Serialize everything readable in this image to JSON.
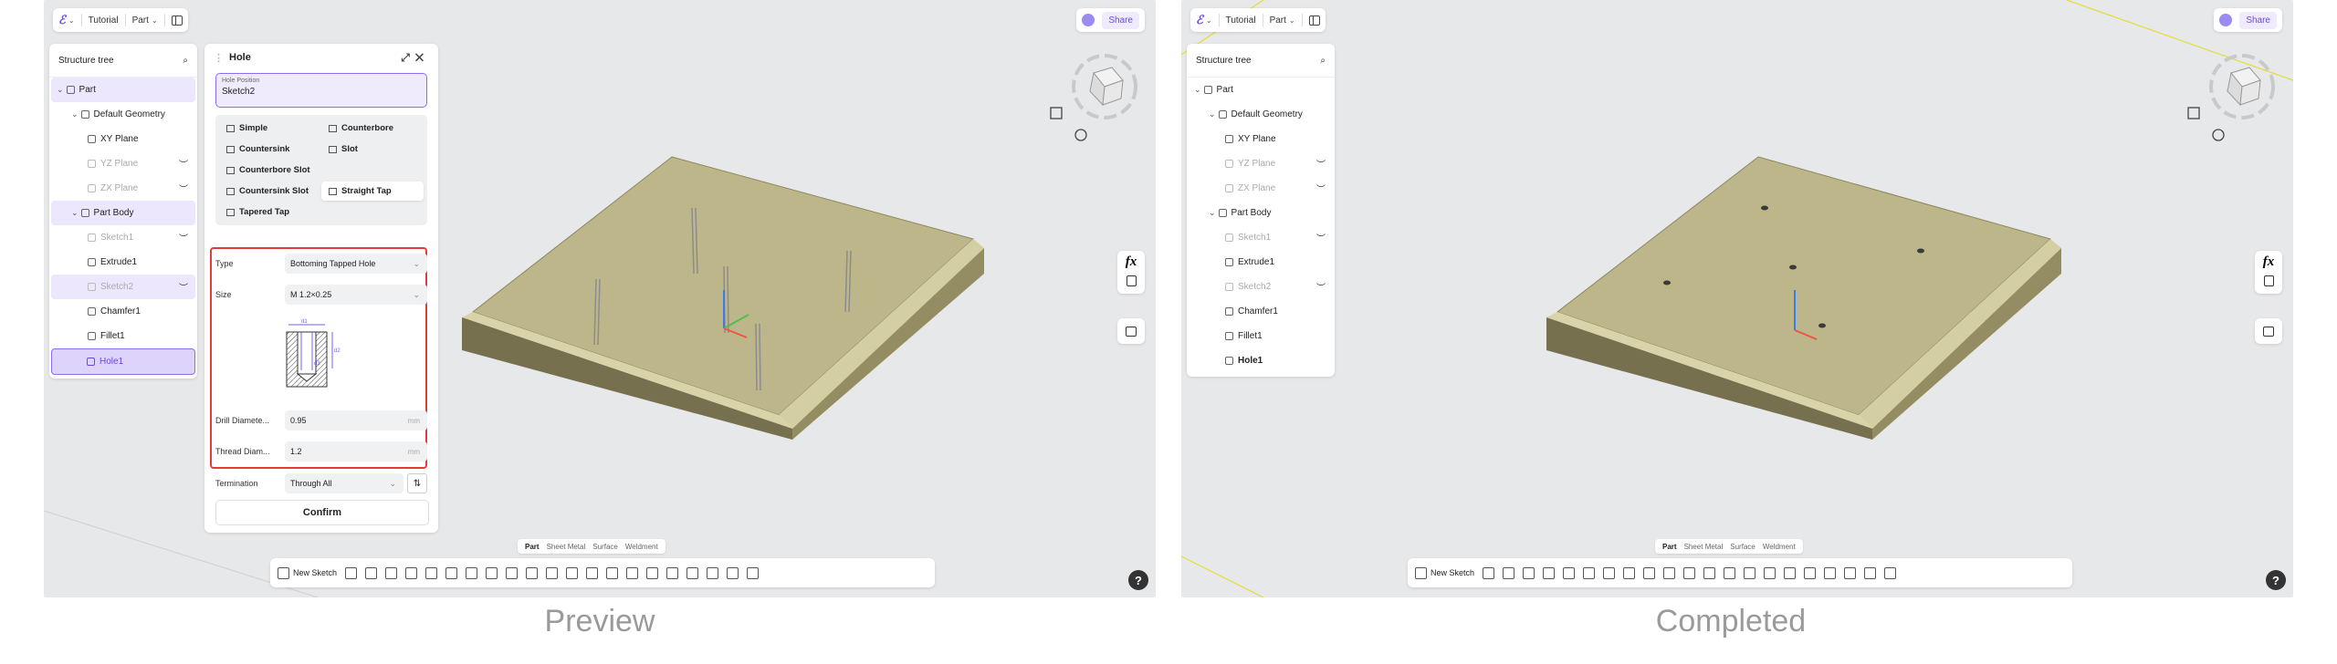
{
  "left": {
    "topbar": {
      "logo": "ℰ",
      "project": "Tutorial",
      "mode": "Part"
    },
    "share": {
      "label": "Share"
    },
    "tree": {
      "title": "Structure tree",
      "items": [
        "Part",
        "Default Geometry",
        "XY Plane",
        "YZ Plane",
        "ZX Plane",
        "Part Body",
        "Sketch1",
        "Extrude1",
        "Sketch2",
        "Chamfer1",
        "Fillet1",
        "Hole1"
      ]
    },
    "hole": {
      "title": "Hole",
      "position_label": "Hole Position",
      "position_value": "Sketch2",
      "types": [
        "Simple",
        "Counterbore",
        "Countersink",
        "Slot",
        "Counterbore Slot",
        "Countersink Slot",
        "Straight Tap",
        "Tapered Tap"
      ],
      "selected_type": "Straight Tap",
      "fields": {
        "type": {
          "label": "Type",
          "value": "Bottoming Tapped Hole"
        },
        "size": {
          "label": "Size",
          "value": "M 1.2×0.25"
        },
        "drill": {
          "label": "Drill Diamete...",
          "value": "0.95",
          "unit": "mm"
        },
        "thread": {
          "label": "Thread Diam...",
          "value": "1.2",
          "unit": "mm"
        },
        "termination": {
          "label": "Termination",
          "value": "Through All"
        }
      },
      "diagram_labels": {
        "d1": "d1",
        "d2": "d2",
        "d3": "d3"
      },
      "confirm": "Confirm"
    },
    "tabs": [
      "Part",
      "Sheet Metal",
      "Surface",
      "Weldment"
    ],
    "toolbar": {
      "new_sketch": "New Sketch"
    },
    "fx": "fx",
    "help": "?"
  },
  "right": {
    "topbar": {
      "logo": "ℰ",
      "project": "Tutorial",
      "mode": "Part"
    },
    "share": {
      "label": "Share"
    },
    "tree": {
      "title": "Structure tree",
      "items": [
        "Part",
        "Default Geometry",
        "XY Plane",
        "YZ Plane",
        "ZX Plane",
        "Part Body",
        "Sketch1",
        "Extrude1",
        "Sketch2",
        "Chamfer1",
        "Fillet1",
        "Hole1"
      ]
    },
    "tabs": [
      "Part",
      "Sheet Metal",
      "Surface",
      "Weldment"
    ],
    "toolbar": {
      "new_sketch": "New Sketch"
    },
    "fx": "fx",
    "help": "?"
  },
  "captions": {
    "left": "Preview",
    "right": "Completed"
  },
  "colors": {
    "accent": "#6a49e0",
    "plate_top": "#bdb68a",
    "highlight": "#e23b3b"
  }
}
